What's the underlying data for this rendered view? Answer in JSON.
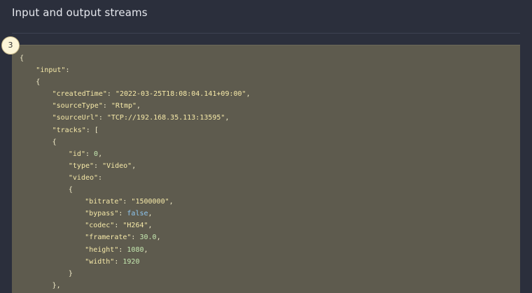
{
  "header": {
    "title": "Input and output streams"
  },
  "step": {
    "number": "3"
  },
  "code": {
    "lines": [
      {
        "indent": 0,
        "tokens": [
          {
            "t": "punct",
            "v": "{"
          }
        ]
      },
      {
        "indent": 1,
        "tokens": [
          {
            "t": "key",
            "v": "\"input\""
          },
          {
            "t": "punct",
            "v": ":"
          }
        ]
      },
      {
        "indent": 1,
        "tokens": [
          {
            "t": "punct",
            "v": "{"
          }
        ]
      },
      {
        "indent": 2,
        "tokens": [
          {
            "t": "key",
            "v": "\"createdTime\""
          },
          {
            "t": "punct",
            "v": ": "
          },
          {
            "t": "str",
            "v": "\"2022-03-25T18:08:04.141+09:00\""
          },
          {
            "t": "punct",
            "v": ","
          }
        ]
      },
      {
        "indent": 2,
        "tokens": [
          {
            "t": "key",
            "v": "\"sourceType\""
          },
          {
            "t": "punct",
            "v": ": "
          },
          {
            "t": "str",
            "v": "\"Rtmp\""
          },
          {
            "t": "punct",
            "v": ","
          }
        ]
      },
      {
        "indent": 2,
        "tokens": [
          {
            "t": "key",
            "v": "\"sourceUrl\""
          },
          {
            "t": "punct",
            "v": ": "
          },
          {
            "t": "str",
            "v": "\"TCP://192.168.35.113:13595\""
          },
          {
            "t": "punct",
            "v": ","
          }
        ]
      },
      {
        "indent": 2,
        "tokens": [
          {
            "t": "key",
            "v": "\"tracks\""
          },
          {
            "t": "punct",
            "v": ": ["
          }
        ]
      },
      {
        "indent": 2,
        "tokens": [
          {
            "t": "punct",
            "v": "{"
          }
        ]
      },
      {
        "indent": 3,
        "tokens": [
          {
            "t": "key",
            "v": "\"id\""
          },
          {
            "t": "punct",
            "v": ": "
          },
          {
            "t": "num",
            "v": "0"
          },
          {
            "t": "punct",
            "v": ","
          }
        ]
      },
      {
        "indent": 3,
        "tokens": [
          {
            "t": "key",
            "v": "\"type\""
          },
          {
            "t": "punct",
            "v": ": "
          },
          {
            "t": "str",
            "v": "\"Video\""
          },
          {
            "t": "punct",
            "v": ","
          }
        ]
      },
      {
        "indent": 3,
        "tokens": [
          {
            "t": "key",
            "v": "\"video\""
          },
          {
            "t": "punct",
            "v": ":"
          }
        ]
      },
      {
        "indent": 3,
        "tokens": [
          {
            "t": "punct",
            "v": "{"
          }
        ]
      },
      {
        "indent": 4,
        "tokens": [
          {
            "t": "key",
            "v": "\"bitrate\""
          },
          {
            "t": "punct",
            "v": ": "
          },
          {
            "t": "str",
            "v": "\"1500000\""
          },
          {
            "t": "punct",
            "v": ","
          }
        ]
      },
      {
        "indent": 4,
        "tokens": [
          {
            "t": "key",
            "v": "\"bypass\""
          },
          {
            "t": "punct",
            "v": ": "
          },
          {
            "t": "bool",
            "v": "false"
          },
          {
            "t": "punct",
            "v": ","
          }
        ]
      },
      {
        "indent": 4,
        "tokens": [
          {
            "t": "key",
            "v": "\"codec\""
          },
          {
            "t": "punct",
            "v": ": "
          },
          {
            "t": "str",
            "v": "\"H264\""
          },
          {
            "t": "punct",
            "v": ","
          }
        ]
      },
      {
        "indent": 4,
        "tokens": [
          {
            "t": "key",
            "v": "\"framerate\""
          },
          {
            "t": "punct",
            "v": ": "
          },
          {
            "t": "num",
            "v": "30.0"
          },
          {
            "t": "punct",
            "v": ","
          }
        ]
      },
      {
        "indent": 4,
        "tokens": [
          {
            "t": "key",
            "v": "\"height\""
          },
          {
            "t": "punct",
            "v": ": "
          },
          {
            "t": "num",
            "v": "1080"
          },
          {
            "t": "punct",
            "v": ","
          }
        ]
      },
      {
        "indent": 4,
        "tokens": [
          {
            "t": "key",
            "v": "\"width\""
          },
          {
            "t": "punct",
            "v": ": "
          },
          {
            "t": "num",
            "v": "1920"
          }
        ]
      },
      {
        "indent": 3,
        "tokens": [
          {
            "t": "punct",
            "v": "}"
          }
        ]
      },
      {
        "indent": 2,
        "tokens": [
          {
            "t": "punct",
            "v": "},"
          }
        ]
      }
    ]
  }
}
